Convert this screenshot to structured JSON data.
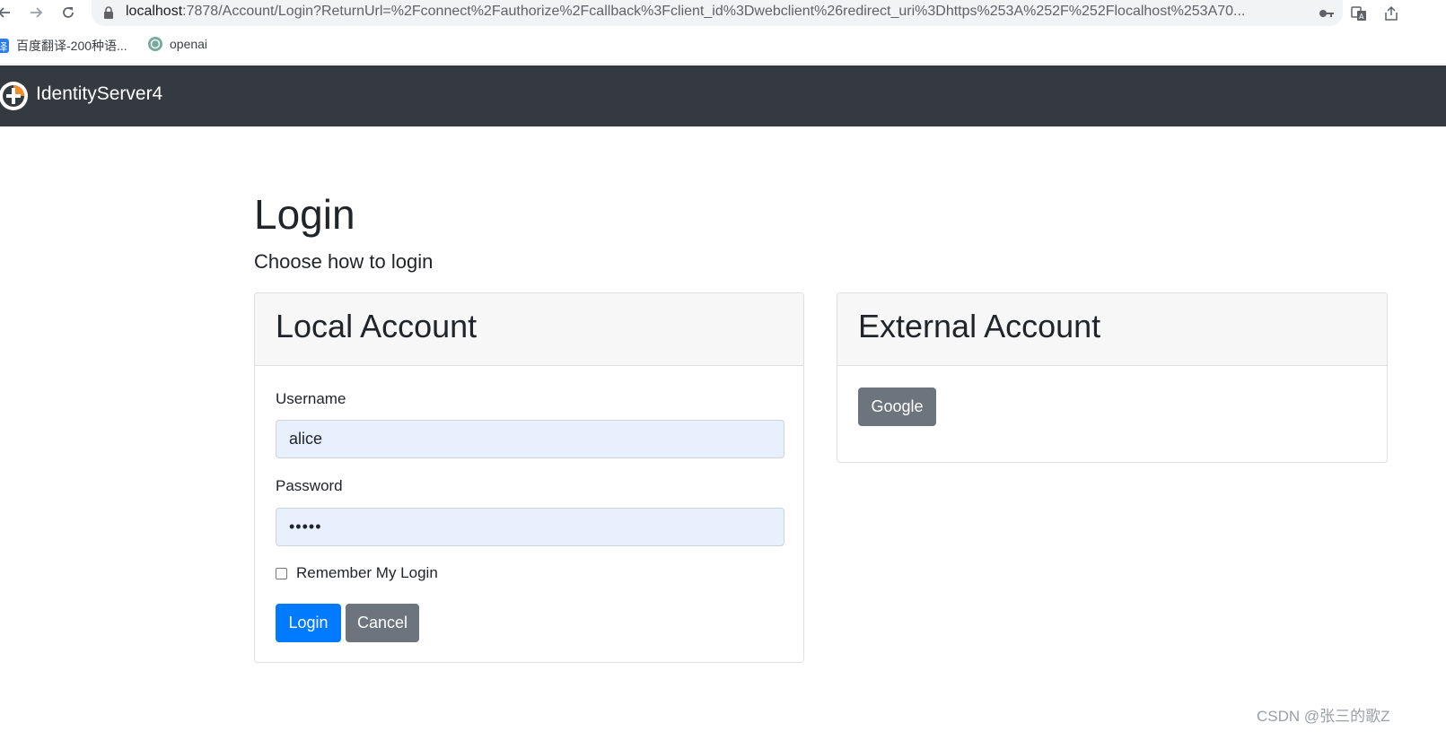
{
  "browser": {
    "url_host": "localhost",
    "url_rest": ":7878/Account/Login?ReturnUrl=%2Fconnect%2Fauthorize%2Fcallback%3Fclient_id%3Dwebclient%26redirect_uri%3Dhttps%253A%252F%252Flocalhost%253A70...",
    "bookmarks": [
      {
        "label": "百度翻译-200种语...",
        "icon": "baidu-translate-icon"
      },
      {
        "label": "openai",
        "icon": "openai-icon"
      }
    ]
  },
  "navbar": {
    "brand": "IdentityServer4"
  },
  "page": {
    "title": "Login",
    "lead": "Choose how to login"
  },
  "local_account": {
    "title": "Local Account",
    "username_label": "Username",
    "username_value": "alice",
    "password_label": "Password",
    "password_value": "•••••",
    "remember_label": "Remember My Login",
    "remember_checked": false,
    "login_button": "Login",
    "cancel_button": "Cancel"
  },
  "external_account": {
    "title": "External Account",
    "providers": [
      "Google"
    ]
  },
  "watermark": "CSDN @张三的歌Z",
  "colors": {
    "navbar": "#343a40",
    "primary": "#007bff",
    "secondary": "#6c757d",
    "autofill": "#e8f0fe"
  }
}
